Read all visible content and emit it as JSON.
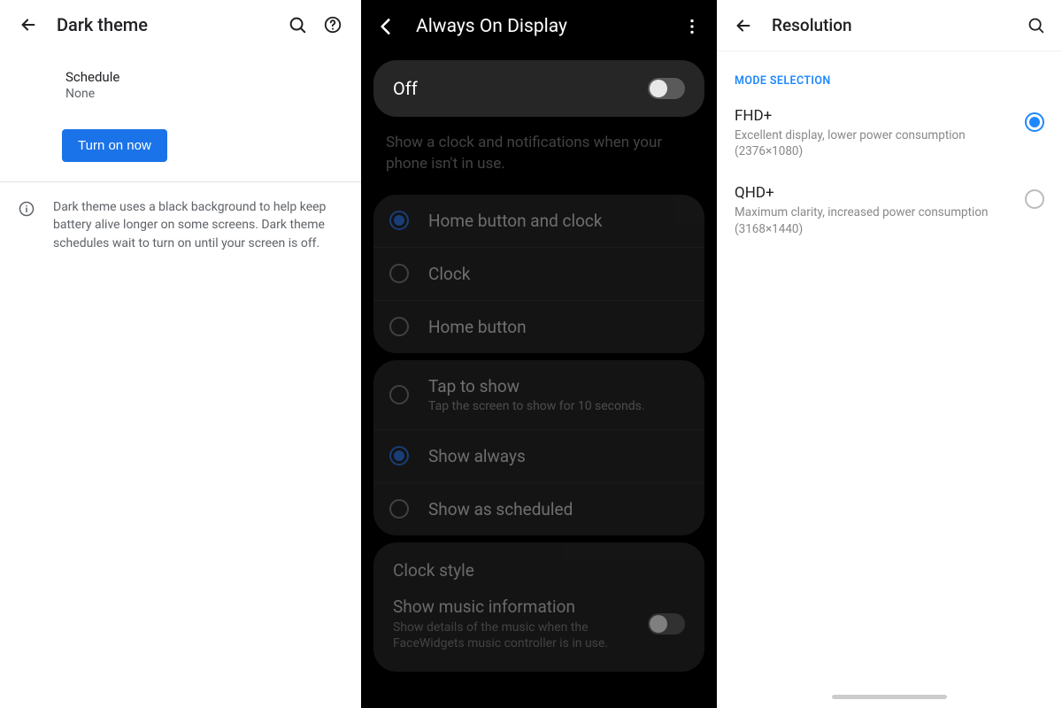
{
  "panel1": {
    "title": "Dark theme",
    "schedule_label": "Schedule",
    "schedule_value": "None",
    "turn_on_button": "Turn on now",
    "info_text": "Dark theme uses a black background to help keep battery alive longer on some screens. Dark theme schedules wait to turn on until your screen is off."
  },
  "panel2": {
    "title": "Always On Display",
    "toggle_label": "Off",
    "toggle_on": false,
    "description": "Show a clock and notifications when your phone isn't in use.",
    "group1": [
      {
        "label": "Home button and clock",
        "selected": true
      },
      {
        "label": "Clock",
        "selected": false
      },
      {
        "label": "Home button",
        "selected": false
      }
    ],
    "group2": [
      {
        "label": "Tap to show",
        "sub": "Tap the screen to show for 10 seconds.",
        "selected": false
      },
      {
        "label": "Show always",
        "selected": true
      },
      {
        "label": "Show as scheduled",
        "selected": false
      }
    ],
    "clock_style": "Clock style",
    "music_title": "Show music information",
    "music_sub": "Show details of the music when the FaceWidgets music controller is in use.",
    "music_on": false
  },
  "panel3": {
    "title": "Resolution",
    "section_label": "MODE SELECTION",
    "options": [
      {
        "title": "FHD+",
        "sub": "Excellent display, lower power consumption (2376×1080)",
        "selected": true
      },
      {
        "title": "QHD+",
        "sub": "Maximum clarity, increased power consumption (3168×1440)",
        "selected": false
      }
    ]
  }
}
